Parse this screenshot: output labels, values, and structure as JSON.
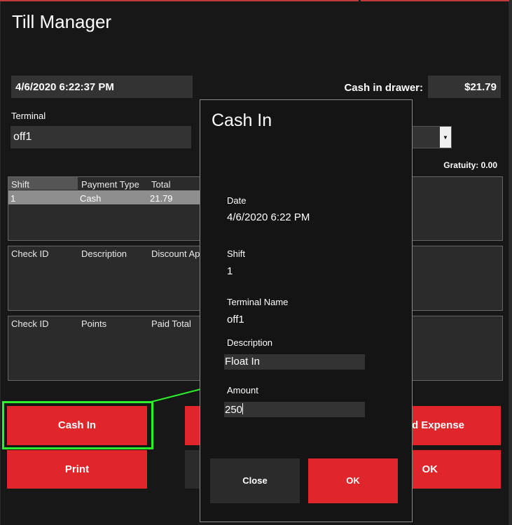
{
  "window": {
    "title": "Till Manager"
  },
  "header": {
    "datetime": "4/6/2020 6:22:37 PM",
    "cash_in_drawer_label": "Cash in drawer:",
    "cash_in_drawer_value": "$21.79",
    "terminal_label": "Terminal",
    "terminal_value": "off1",
    "gratuity": "Gratuity: 0.00"
  },
  "payments_table": {
    "columns": [
      "Shift",
      "Payment Type",
      "Total"
    ],
    "rows": [
      {
        "shift": "1",
        "payment_type": "Cash",
        "total": "21.79"
      }
    ]
  },
  "discounts_table": {
    "columns": [
      "Check ID",
      "Description",
      "Discount Ap"
    ]
  },
  "points_table": {
    "columns": [
      "Check ID",
      "Points",
      "Paid Total"
    ]
  },
  "buttons": {
    "cash_in": "Cash In",
    "print": "Print",
    "add_expense": "d Expense",
    "ok": "OK"
  },
  "dialog": {
    "title": "Cash In",
    "date_label": "Date",
    "date_value": "4/6/2020 6:22 PM",
    "shift_label": "Shift",
    "shift_value": "1",
    "terminal_label": "Terminal Name",
    "terminal_value": "off1",
    "description_label": "Description",
    "description_value": "Float In",
    "amount_label": "Amount",
    "amount_value": "250",
    "close_button": "Close",
    "ok_button": "OK"
  },
  "colors": {
    "accent_red": "#e0252b",
    "highlight_green": "#2cf02c"
  }
}
